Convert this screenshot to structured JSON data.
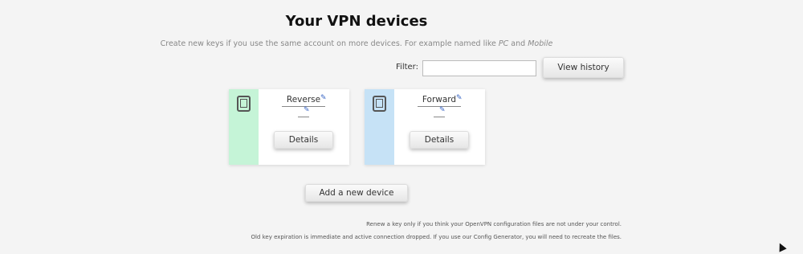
{
  "page": {
    "title": "Your VPN devices",
    "subtitle_prefix": "Create new keys if you use the same account on more devices. For example named like ",
    "subtitle_pc": "PC",
    "subtitle_and": " and ",
    "subtitle_mobile": "Mobile"
  },
  "filter": {
    "label": "Filter:",
    "value": "",
    "placeholder": ""
  },
  "history_button": {
    "label": "View history"
  },
  "devices": [
    {
      "name": "Reverse",
      "description": "",
      "details_label": "Details",
      "color": "#c5f4d7",
      "icon": "tablet-icon"
    },
    {
      "name": "Forward",
      "description": "",
      "details_label": "Details",
      "color": "#c6e2f6",
      "icon": "tablet-icon"
    }
  ],
  "add_button": {
    "label": "Add a new device"
  },
  "notes": {
    "line1": "Renew a key only if you think your OpenVPN configuration files are not under your control.",
    "line2": "Old key expiration is immediate and active connection dropped. If you use our Config Generator, you will need to recreate the files."
  },
  "icons": {
    "edit": "pencil-icon",
    "device": "tablet-icon",
    "cursor": "mouse-cursor-icon"
  }
}
